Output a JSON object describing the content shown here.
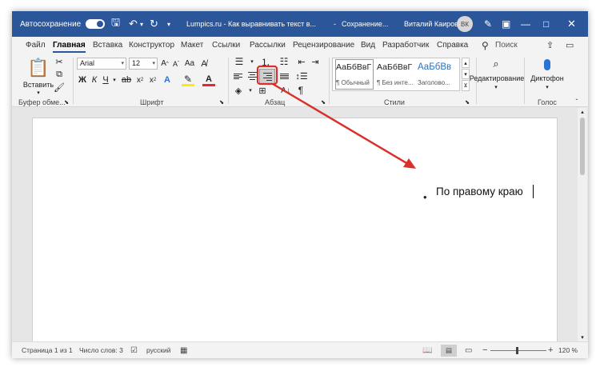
{
  "titlebar": {
    "autosave_label": "Автосохранение",
    "doc_title": "Lumpics.ru - Как выравнивать текст в...",
    "separator": "-",
    "save_status": "Сохранение...",
    "user_name": "Виталий Каиров",
    "user_initials": "ВК"
  },
  "menu": {
    "tabs": [
      "Файл",
      "Главная",
      "Вставка",
      "Конструктор",
      "Макет",
      "Ссылки",
      "Рассылки",
      "Рецензирование",
      "Вид",
      "Разработчик",
      "Справка"
    ],
    "search_label": "Поиск"
  },
  "ribbon": {
    "clipboard": {
      "paste_label": "Вставить",
      "group_label": "Буфер обме..."
    },
    "font": {
      "font_name": "Arial",
      "font_size": "12",
      "bold": "Ж",
      "italic": "К",
      "underline": "Ч",
      "group_label": "Шрифт"
    },
    "paragraph": {
      "group_label": "Абзац",
      "show_marks": "¶"
    },
    "styles": {
      "items": [
        {
          "sample": "АаБбВвГ",
          "name": "¶ Обычный"
        },
        {
          "sample": "АаБбВвГ",
          "name": "¶ Без инте..."
        },
        {
          "sample": "АаБбВв",
          "name": "Заголово..."
        }
      ],
      "group_label": "Стили"
    },
    "editing": {
      "label": "Редактирование"
    },
    "voice": {
      "label": "Диктофон",
      "group_label": "Голос"
    },
    "highlight_color": "#d9302b"
  },
  "document": {
    "bullet": "•",
    "text": "По правому краю"
  },
  "statusbar": {
    "page": "Страница 1 из 1",
    "words": "Число слов: 3",
    "language": "русский",
    "zoom_minus": "−",
    "zoom_plus": "+",
    "zoom": "120 %"
  }
}
